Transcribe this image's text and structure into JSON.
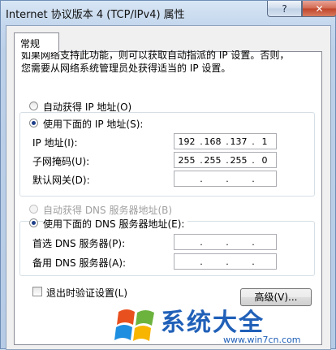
{
  "window": {
    "title": "Internet 协议版本 4 (TCP/IPv4) 属性",
    "help_glyph": "?",
    "close_glyph": "✕"
  },
  "tabs": [
    {
      "label": "常规"
    }
  ],
  "description": {
    "line1": "如果网络支持此功能，则可以获取自动指派的 IP 设置。否则，",
    "line2": "您需要从网络系统管理员处获得适当的 IP 设置。"
  },
  "ip_section": {
    "auto_label": "自动获得 IP 地址(O)",
    "manual_label": "使用下面的 IP 地址(S):",
    "selected": "manual",
    "ip_address": {
      "label": "IP 地址(I):",
      "octets": [
        "192",
        "168",
        "137",
        "1"
      ]
    },
    "subnet_mask": {
      "label": "子网掩码(U):",
      "octets": [
        "255",
        "255",
        "255",
        "0"
      ]
    },
    "default_gateway": {
      "label": "默认网关(D):",
      "octets": [
        "",
        "",
        "",
        ""
      ]
    }
  },
  "dns_section": {
    "auto_label": "自动获得 DNS 服务器地址(B)",
    "manual_label": "使用下面的 DNS 服务器地址(E):",
    "selected": "manual",
    "preferred": {
      "label": "首选 DNS 服务器(P):",
      "octets": [
        "",
        "",
        "",
        ""
      ]
    },
    "alternate": {
      "label": "备用 DNS 服务器(A):",
      "octets": [
        "",
        "",
        "",
        ""
      ]
    }
  },
  "validate_checkbox": {
    "label": "退出时验证设置(L)",
    "checked": false
  },
  "advanced_button": {
    "label": "高级(V)..."
  },
  "watermark": {
    "text": "系统大全",
    "url": "www.win7cn.com"
  },
  "colors": {
    "watermark_blue": "#2060b8",
    "close_red": "#c0432a"
  }
}
